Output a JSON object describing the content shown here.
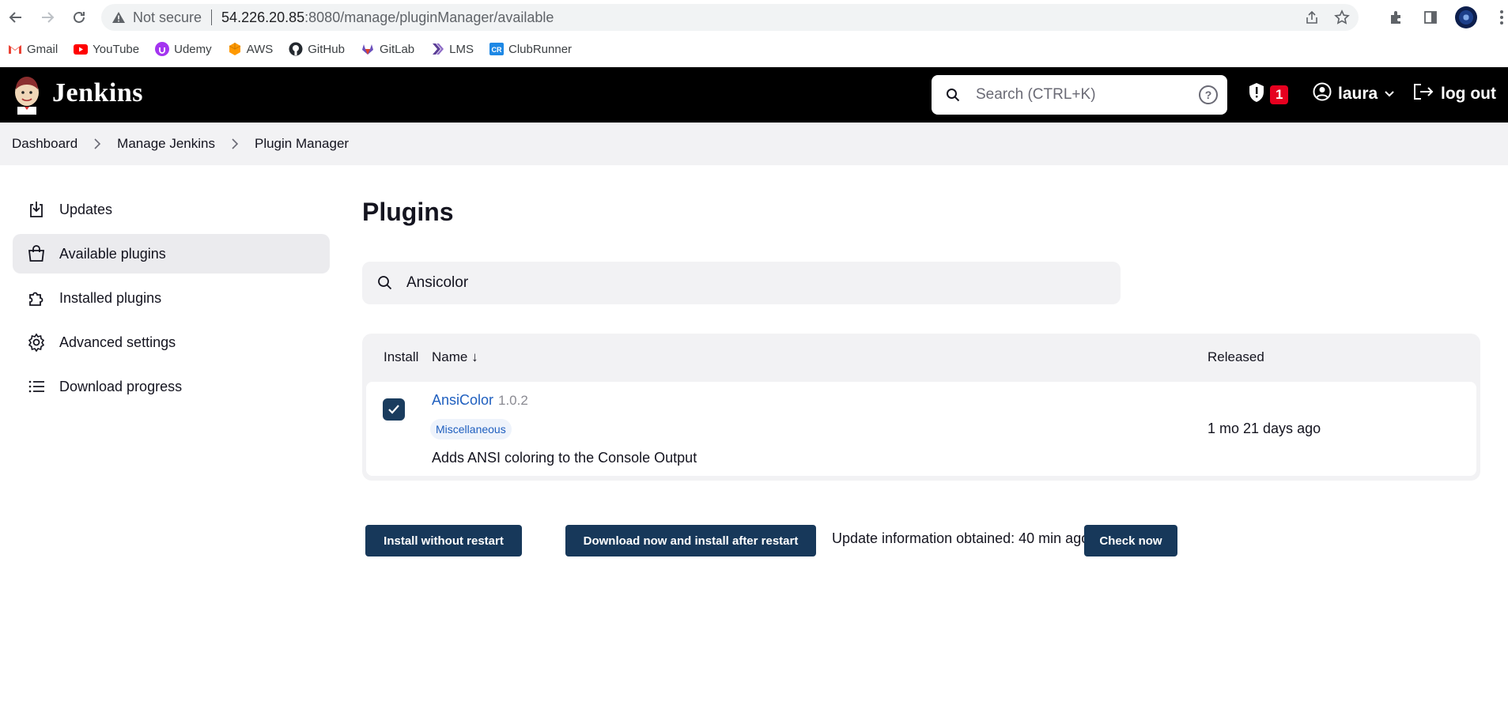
{
  "browser": {
    "not_secure": "Not secure",
    "url_host": "54.226.20.85",
    "url_path": ":8080/manage/pluginManager/available",
    "bookmarks": [
      {
        "label": "Gmail",
        "icon": "gmail-icon",
        "color": "#ea4335"
      },
      {
        "label": "YouTube",
        "icon": "youtube-icon",
        "color": "#ff0000"
      },
      {
        "label": "Udemy",
        "icon": "udemy-icon",
        "color": "#a435f0"
      },
      {
        "label": "AWS",
        "icon": "aws-icon",
        "color": "#ff9900"
      },
      {
        "label": "GitHub",
        "icon": "github-icon",
        "color": "#24292f"
      },
      {
        "label": "GitLab",
        "icon": "gitlab-icon",
        "color": "#6b4fbb"
      },
      {
        "label": "LMS",
        "icon": "lms-icon",
        "color": "#5b3e96"
      },
      {
        "label": "ClubRunner",
        "icon": "clubrunner-icon",
        "color": "#1e88e5"
      }
    ]
  },
  "header": {
    "app_title": "Jenkins",
    "search_placeholder": "Search (CTRL+K)",
    "help_glyph": "?",
    "security_count": "1",
    "user": "laura",
    "logout": "log out"
  },
  "breadcrumb": [
    "Dashboard",
    "Manage Jenkins",
    "Plugin Manager"
  ],
  "sidebar": {
    "items": [
      {
        "label": "Updates",
        "icon": "download-icon"
      },
      {
        "label": "Available plugins",
        "icon": "shopping-bag-icon",
        "active": true
      },
      {
        "label": "Installed plugins",
        "icon": "puzzle-icon"
      },
      {
        "label": "Advanced settings",
        "icon": "gear-icon"
      },
      {
        "label": "Download progress",
        "icon": "list-icon"
      }
    ]
  },
  "main": {
    "title": "Plugins",
    "filter_value": "Ansicolor",
    "table": {
      "col_install": "Install",
      "col_name": "Name ↓",
      "col_released": "Released",
      "rows": [
        {
          "name": "AnsiColor",
          "version": "1.0.2",
          "category": "Miscellaneous",
          "description": "Adds ANSI coloring to the Console Output",
          "released": "1 mo 21 days ago",
          "checked": true
        }
      ]
    },
    "buttons": {
      "install_now": "Install without restart",
      "install_after_restart": "Download now and install after restart",
      "check_now": "Check now"
    },
    "update_info": "Update information obtained: 40 min ago"
  },
  "colors": {
    "header_bg": "#000000",
    "button_bg": "#17385a",
    "link": "#1f5fbf",
    "badge": "#e6001f"
  }
}
